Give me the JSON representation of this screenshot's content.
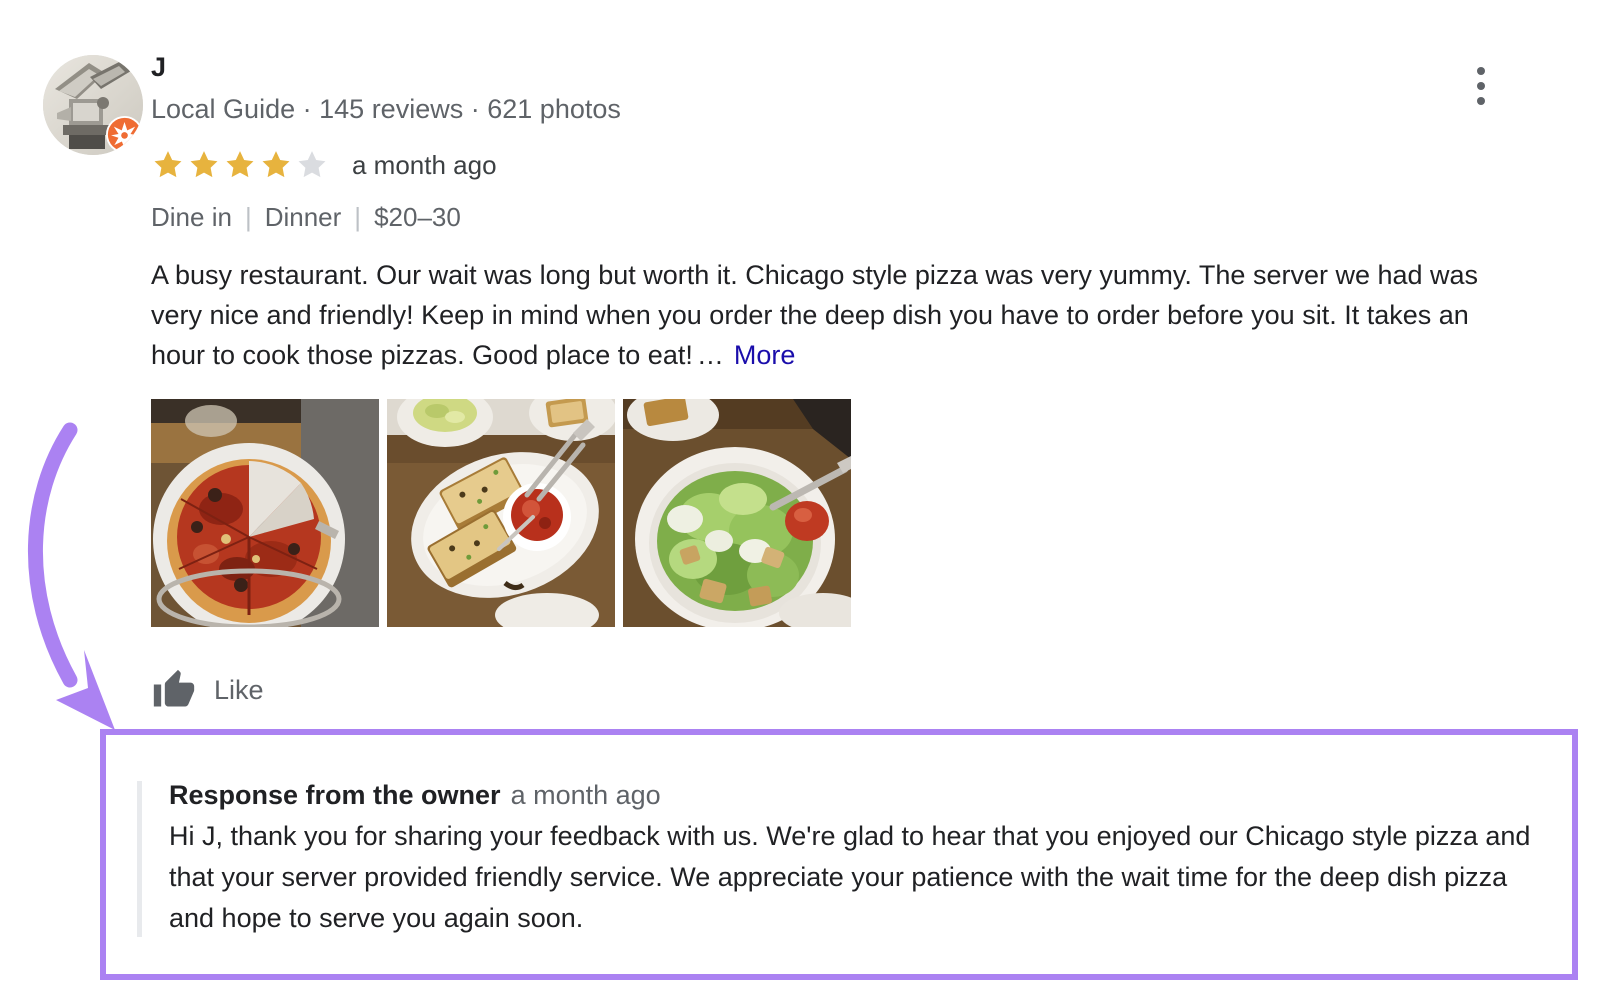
{
  "review": {
    "author_name": "J",
    "local_guide_label": "Local Guide",
    "reviews_count": "145 reviews",
    "photos_count": "621 photos",
    "meta_separator": "·",
    "rating": 4,
    "max_rating": 5,
    "age": "a month ago",
    "attributes": [
      "Dine in",
      "Dinner",
      "$20–30"
    ],
    "attribute_divider": "|",
    "text": "A busy restaurant. Our wait was long but worth it. Chicago style pizza was very yummy. The server we had was very nice and friendly! Keep in mind when you order the deep dish you have to order before you sit. It takes an hour to cook those pizzas. Good place to eat!",
    "ellipsis": "…",
    "more_link_label": "More",
    "photos": [
      {
        "alt": "deep-dish-pizza-photo"
      },
      {
        "alt": "garlic-bread-with-marinara-photo"
      },
      {
        "alt": "caesar-salad-photo"
      }
    ],
    "like_label": "Like"
  },
  "owner_response": {
    "title": "Response from the owner",
    "age": "a month ago",
    "body": "Hi J, thank you for sharing your feedback with us. We're glad to hear that you enjoyed our Chicago style pizza and that your server provided friendly service. We appreciate your patience with the wait time for the deep dish pizza and hope to serve you again soon."
  },
  "icons": {
    "overflow": "three-dot-menu-icon",
    "thumb": "thumbs-up-icon",
    "local_guide_badge": "local-guide-badge-icon"
  },
  "colors": {
    "annotation_purple": "#ab82f2",
    "star_gold": "#e7b33e",
    "star_empty": "#dadce0",
    "link_blue": "#1a0dab",
    "text_primary": "#202124",
    "text_secondary": "#5f6368"
  }
}
